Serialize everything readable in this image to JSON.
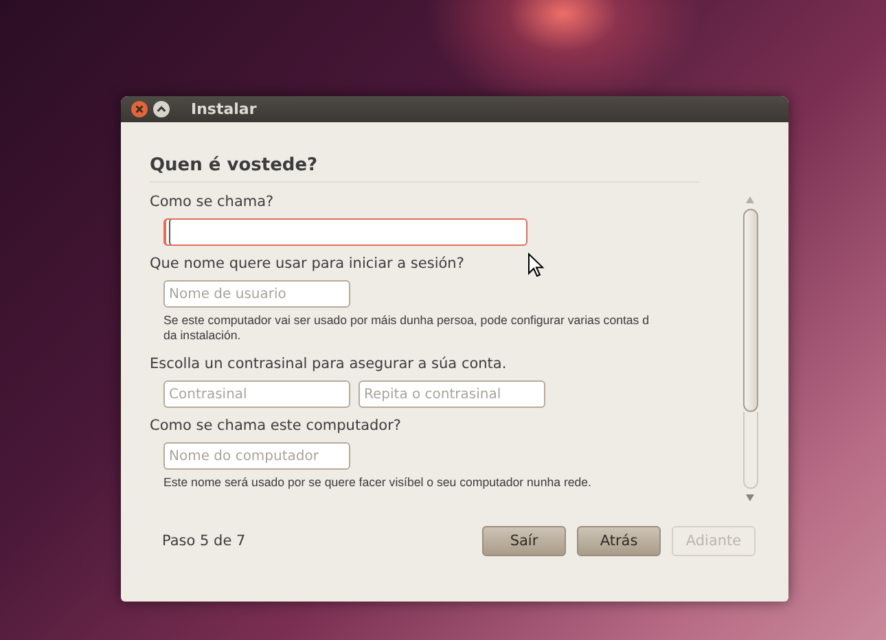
{
  "window": {
    "title": "Instalar"
  },
  "heading": "Quen é vostede?",
  "sections": [
    {
      "label": "Como se chama?",
      "fields": [
        {
          "focused": true,
          "kind": "wide"
        }
      ]
    },
    {
      "label": "Que nome quere usar para iniciar a sesión?",
      "fields": [
        {
          "placeholder": "Nome de usuario",
          "focused": false,
          "kind": "short"
        }
      ],
      "hint_lines": [
        "Se este computador vai ser usado por máis dunha persoa, pode configurar varias contas d",
        "da instalación."
      ]
    },
    {
      "label": "Escolla un contrasinal para asegurar a súa conta.",
      "fields": [
        {
          "placeholder": "Contrasinal",
          "focused": false,
          "kind": "short"
        },
        {
          "placeholder": "Repita o contrasinal",
          "focused": false,
          "kind": "short"
        }
      ]
    },
    {
      "label": "Como se chama este computador?",
      "fields": [
        {
          "placeholder": "Nome do computador",
          "focused": false,
          "kind": "short"
        }
      ],
      "hint_lines": [
        "Este nome será usado por se quere facer visíbel o seu computador nunha rede."
      ]
    }
  ],
  "step": "Paso 5 de 7",
  "buttons": [
    {
      "label": "Saír",
      "disabled": false
    },
    {
      "label": "Atrás",
      "disabled": false
    },
    {
      "label": "Adiante",
      "disabled": true
    }
  ]
}
